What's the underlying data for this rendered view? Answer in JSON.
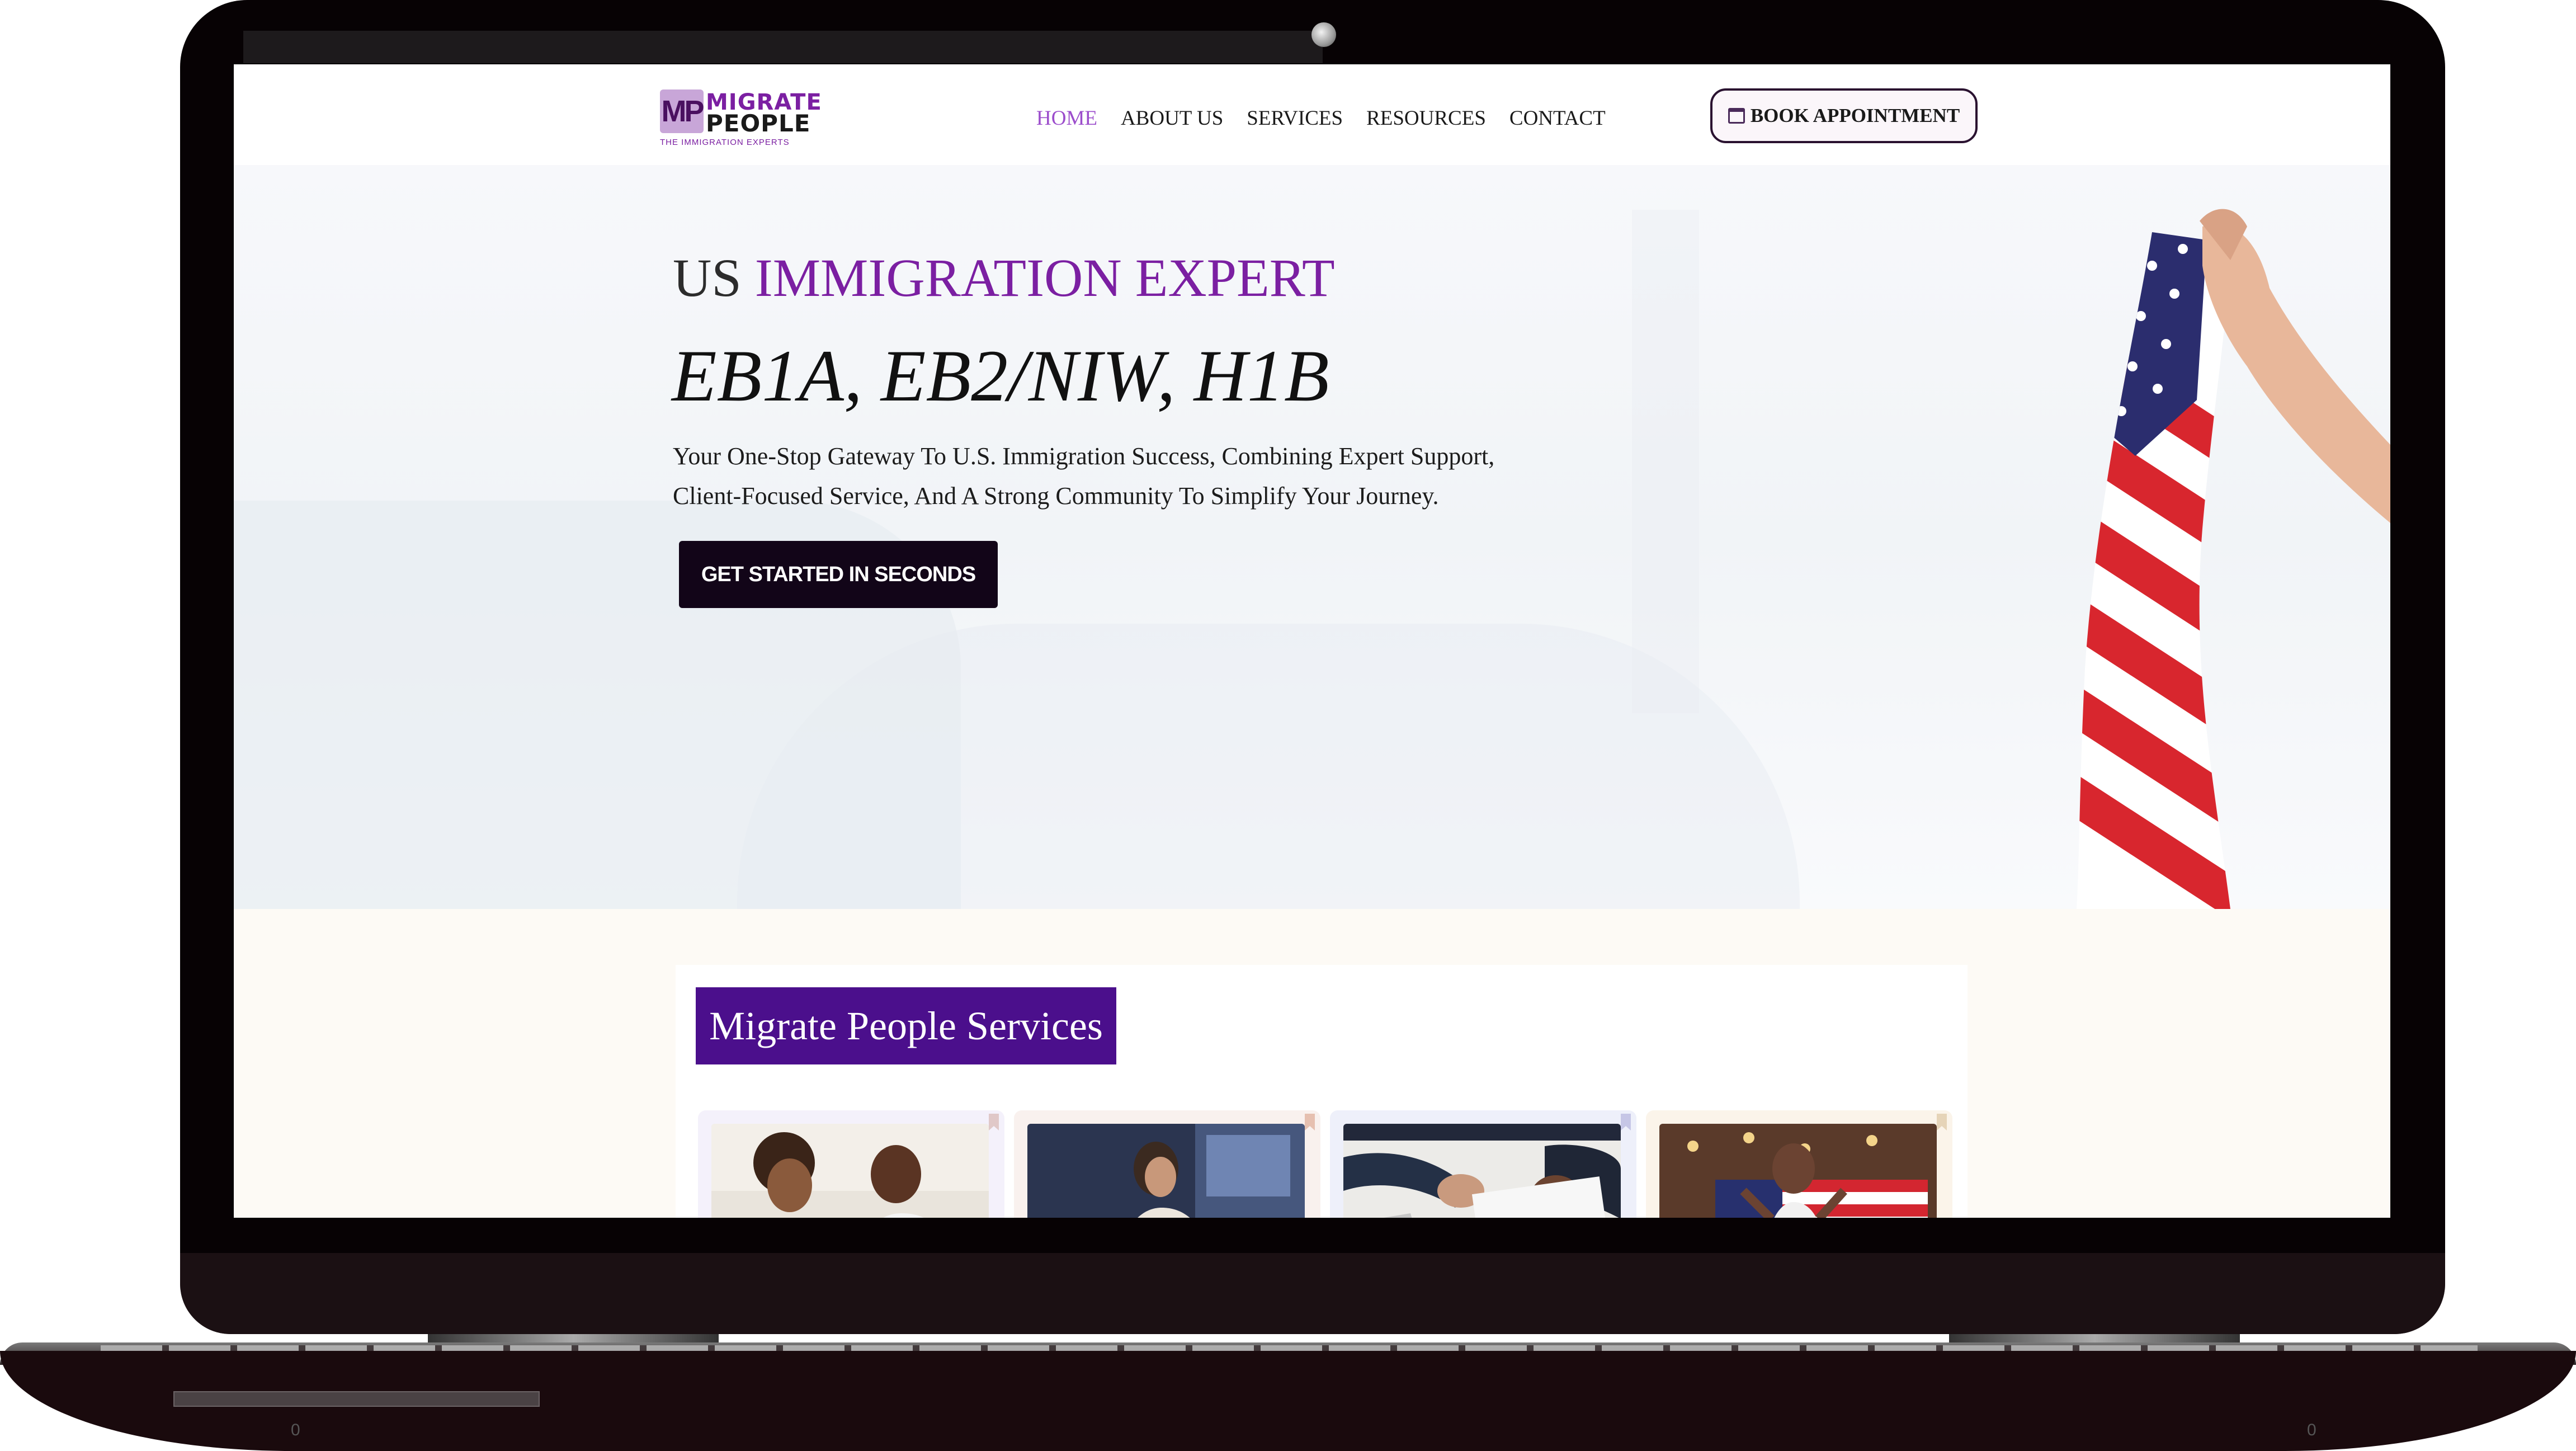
{
  "header": {
    "logo": {
      "mark": "MP",
      "line1": "MIGRATE",
      "line2": "PEOPLE",
      "tagline": "THE IMMIGRATION EXPERTS"
    },
    "nav": [
      {
        "label": "HOME",
        "active": true
      },
      {
        "label": "ABOUT US",
        "active": false
      },
      {
        "label": "SERVICES",
        "active": false
      },
      {
        "label": "RESOURCES",
        "active": false
      },
      {
        "label": "CONTACT",
        "active": false
      }
    ],
    "book_label": "BOOK APPOINTMENT"
  },
  "hero": {
    "title_prefix": "US",
    "title_accent": "IMMIGRATION EXPERT",
    "subtitle": "EB1A, EB2/NIW, H1B",
    "description_lines": [
      "Your One-Stop Gateway To U.S. Immigration Success, Combining Expert Support,",
      "Client-Focused Service, And A Strong Community To Simplify Your Journey."
    ],
    "cta_label": "GET STARTED IN SECONDS"
  },
  "services": {
    "heading": "Migrate People Services",
    "cards": [
      {
        "image": "consultation-photo"
      },
      {
        "image": "office-worker-photo"
      },
      {
        "image": "document-signing-photo"
      },
      {
        "image": "woman-with-us-flag-photo"
      }
    ]
  },
  "device": {
    "base_marks": [
      "0",
      "0"
    ]
  },
  "colors": {
    "brand_purple": "#7b1fa2",
    "nav_active": "#9c4dcc",
    "services_heading_bg": "#4b0f8c",
    "cta_bg": "#120518"
  }
}
